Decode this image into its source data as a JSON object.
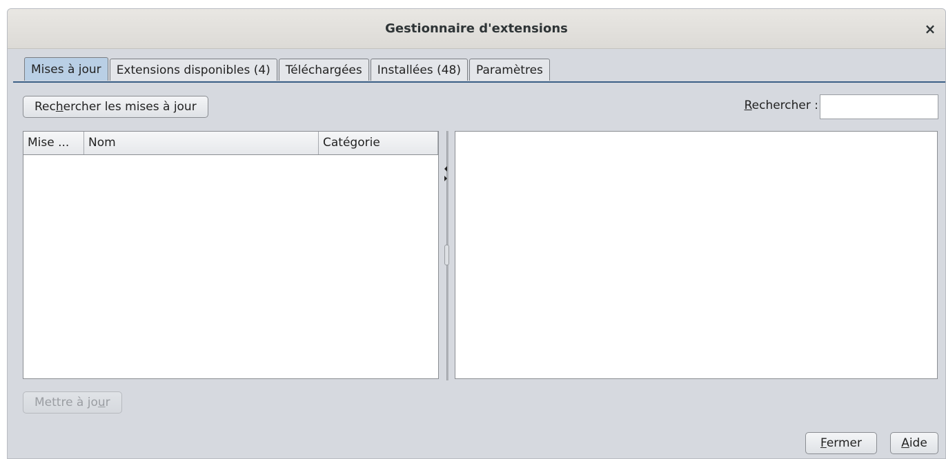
{
  "window": {
    "title": "Gestionnaire d'extensions",
    "close_symbol": "×"
  },
  "tabs": [
    {
      "label": "Mises à jour",
      "active": true
    },
    {
      "label": "Extensions disponibles (4)",
      "active": false
    },
    {
      "label": "Téléchargées",
      "active": false
    },
    {
      "label": "Installées (48)",
      "active": false
    },
    {
      "label": "Paramètres",
      "active": false
    }
  ],
  "toolbar": {
    "check_updates": {
      "before": "Rec",
      "mnemonic": "h",
      "after": "ercher les mises à jour"
    },
    "search_label": {
      "mnemonic": "R",
      "after": "echercher :"
    },
    "search_value": ""
  },
  "table": {
    "columns": [
      "Mise ...",
      "Nom",
      "Catégorie"
    ],
    "rows": []
  },
  "footer": {
    "update": {
      "before": "Mettre à jo",
      "mnemonic": "u",
      "after": "r",
      "disabled": true
    },
    "close": {
      "mnemonic": "F",
      "after": "ermer"
    },
    "help": {
      "mnemonic": "A",
      "after": "ide"
    }
  },
  "icons": {
    "close": "close-icon",
    "collapse_left": "arrow-left-icon",
    "collapse_right": "arrow-right-icon",
    "split_grip": "grip-icon"
  },
  "colors": {
    "window_bg": "#d6d9df",
    "active_tab": "#b9cfe5",
    "tab_underline": "#3b5f86"
  }
}
